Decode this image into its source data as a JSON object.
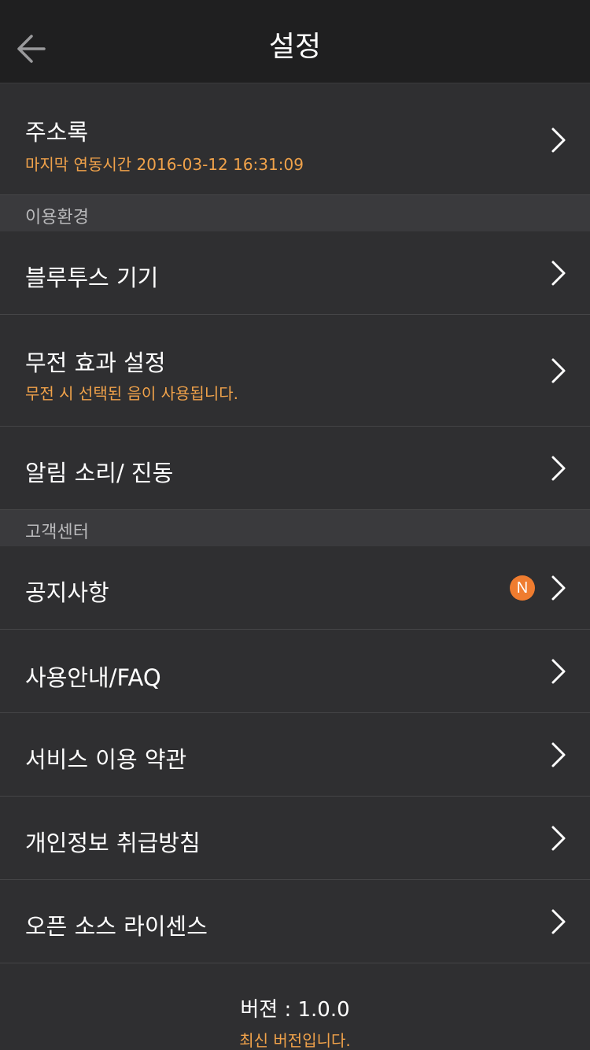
{
  "header": {
    "title": "설정",
    "back_icon": "arrow-left-icon"
  },
  "contacts": {
    "title": "주소록",
    "subtitle": "마지막 연동시간 2016-03-12 16:31:09"
  },
  "section_env": {
    "label": "이용환경"
  },
  "bluetooth": {
    "title": "블루투스 기기"
  },
  "mute_effect": {
    "title": "무전 효과 설정",
    "subtitle": "무전 시 선택된 음이 사용됩니다."
  },
  "alert_sound": {
    "title": "알림 소리/ 진동"
  },
  "section_cs": {
    "label": "고객센터"
  },
  "notice": {
    "title": "공지사항",
    "badge": "N"
  },
  "guide": {
    "title": "사용안내/FAQ"
  },
  "terms": {
    "title": "서비스 이용 약관"
  },
  "privacy": {
    "title": "개인정보 취급방침"
  },
  "license": {
    "title": "오픈 소스 라이센스"
  },
  "footer": {
    "version": "버젼 : 1.0.0",
    "status": "최신 버전입니다."
  },
  "colors": {
    "accent": "#f0a24a",
    "badge": "#ef7c2f",
    "background": "#2f2f31",
    "header": "#1f1f20"
  }
}
